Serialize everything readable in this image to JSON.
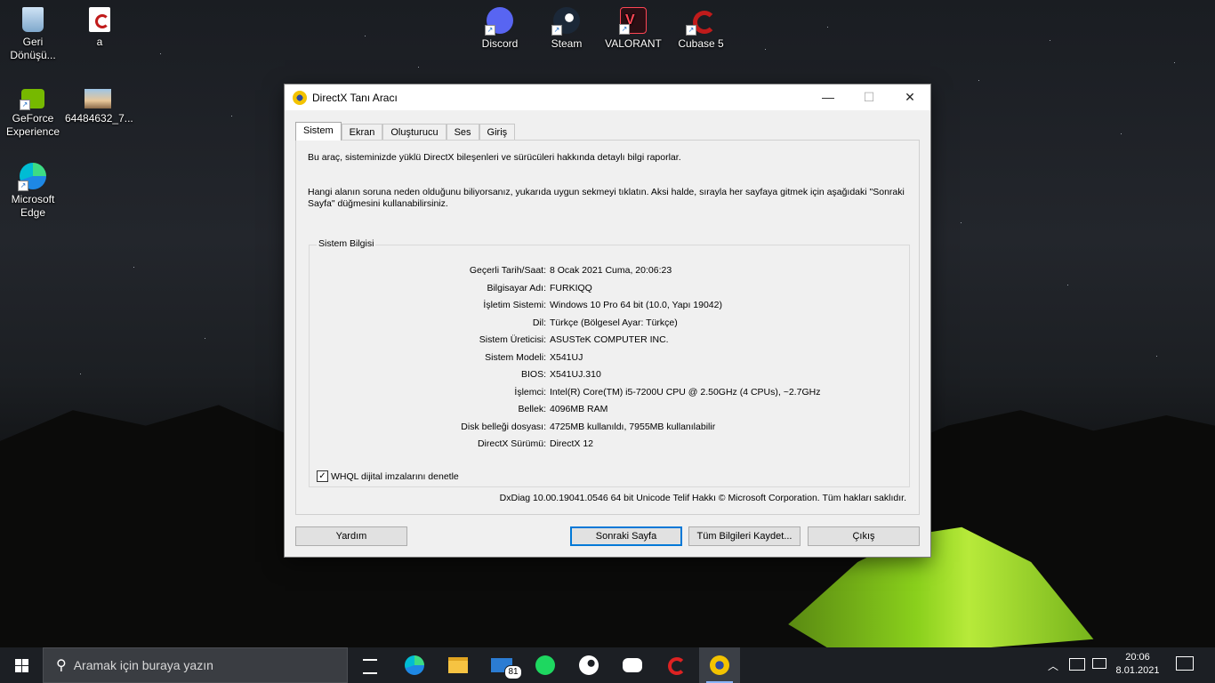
{
  "desktop": {
    "icons": [
      {
        "label": "Geri\nDönüşü...",
        "icon": "recycle-bin-icon"
      },
      {
        "label": "a",
        "icon": "cubase-project-icon"
      },
      {
        "label": "GeForce\nExperience",
        "icon": "nvidia-geforce-icon"
      },
      {
        "label": "64484632_7...",
        "icon": "image-file-icon"
      },
      {
        "label": "Microsoft\nEdge",
        "icon": "edge-icon"
      },
      {
        "label": "Discord",
        "icon": "discord-icon"
      },
      {
        "label": "Steam",
        "icon": "steam-icon"
      },
      {
        "label": "VALORANT",
        "icon": "valorant-icon"
      },
      {
        "label": "Cubase 5",
        "icon": "cubase-icon"
      }
    ]
  },
  "dialog": {
    "title": "DirectX Tanı Aracı",
    "controls": {
      "minimize": "—",
      "maximize": "☐",
      "close": "✕"
    },
    "tabs": [
      "Sistem",
      "Ekran",
      "Oluşturucu",
      "Ses",
      "Giriş"
    ],
    "active_tab": "Sistem",
    "intro1": "Bu araç, sisteminizde yüklü DirectX bileşenleri ve sürücüleri hakkında detaylı bilgi raporlar.",
    "intro2": "Hangi alanın soruna neden olduğunu biliyorsanız, yukarıda uygun sekmeyi tıklatın. Aksi halde, sırayla her sayfaya gitmek için aşağıdaki \"Sonraki Sayfa\" düğmesini kullanabilirsiniz.",
    "group_title": "Sistem Bilgisi",
    "info": [
      {
        "key": "Geçerli Tarih/Saat:",
        "value": "8 Ocak 2021 Cuma, 20:06:23"
      },
      {
        "key": "Bilgisayar Adı:",
        "value": "FURKIQQ"
      },
      {
        "key": "İşletim Sistemi:",
        "value": "Windows 10 Pro 64 bit (10.0, Yapı 19042)"
      },
      {
        "key": "Dil:",
        "value": "Türkçe (Bölgesel Ayar: Türkçe)"
      },
      {
        "key": "Sistem Üreticisi:",
        "value": "ASUSTeK COMPUTER INC."
      },
      {
        "key": "Sistem Modeli:",
        "value": "X541UJ"
      },
      {
        "key": "BIOS:",
        "value": "X541UJ.310"
      },
      {
        "key": "İşlemci:",
        "value": "Intel(R) Core(TM) i5-7200U CPU @ 2.50GHz (4 CPUs), ~2.7GHz"
      },
      {
        "key": "Bellek:",
        "value": "4096MB RAM"
      },
      {
        "key": "Disk belleği dosyası:",
        "value": "4725MB kullanıldı, 7955MB kullanılabilir"
      },
      {
        "key": "DirectX Sürümü:",
        "value": "DirectX 12"
      }
    ],
    "whql_label": "WHQL dijital imzalarını denetle",
    "whql_checked": true,
    "copyright": "DxDiag 10.00.19041.0546 64 bit Unicode  Telif Hakkı © Microsoft Corporation. Tüm hakları saklıdır.",
    "buttons": {
      "help": "Yardım",
      "next": "Sonraki Sayfa",
      "save": "Tüm Bilgileri Kaydet...",
      "exit": "Çıkış"
    }
  },
  "taskbar": {
    "search_placeholder": "Aramak için buraya yazın",
    "mail_badge": "81",
    "time": "20:06",
    "date": "8.01.2021",
    "apps": [
      "task-view-icon",
      "edge-icon",
      "file-explorer-icon",
      "mail-icon",
      "spotify-icon",
      "steam-icon",
      "discord-icon",
      "cubase-icon",
      "directx-icon"
    ]
  },
  "colors": {
    "accent": "#0078d7",
    "taskbar": "#1c1f24",
    "tent_green": "#8ad01c"
  }
}
